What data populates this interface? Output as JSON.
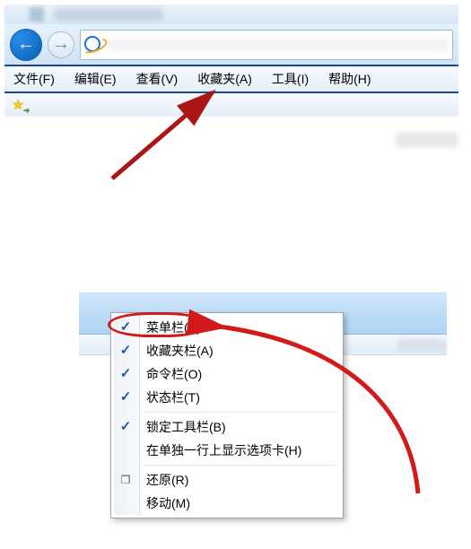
{
  "menubar": {
    "file": "文件(F)",
    "edit": "编辑(E)",
    "view": "查看(V)",
    "favorites": "收藏夹(A)",
    "tools": "工具(I)",
    "help": "帮助(H)"
  },
  "context_menu": {
    "menu_bar": "菜单栏(E)",
    "favorites_bar": "收藏夹栏(A)",
    "command_bar": "命令栏(O)",
    "status_bar": "状态栏(T)",
    "lock_toolbars": "锁定工具栏(B)",
    "show_tabs_separate_row": "在单独一行上显示选项卡(H)",
    "restore": "还原(R)",
    "move": "移动(M)"
  },
  "annotation": {
    "highlight_color": "#d31a1a",
    "arrow_color": "#aa1515"
  }
}
